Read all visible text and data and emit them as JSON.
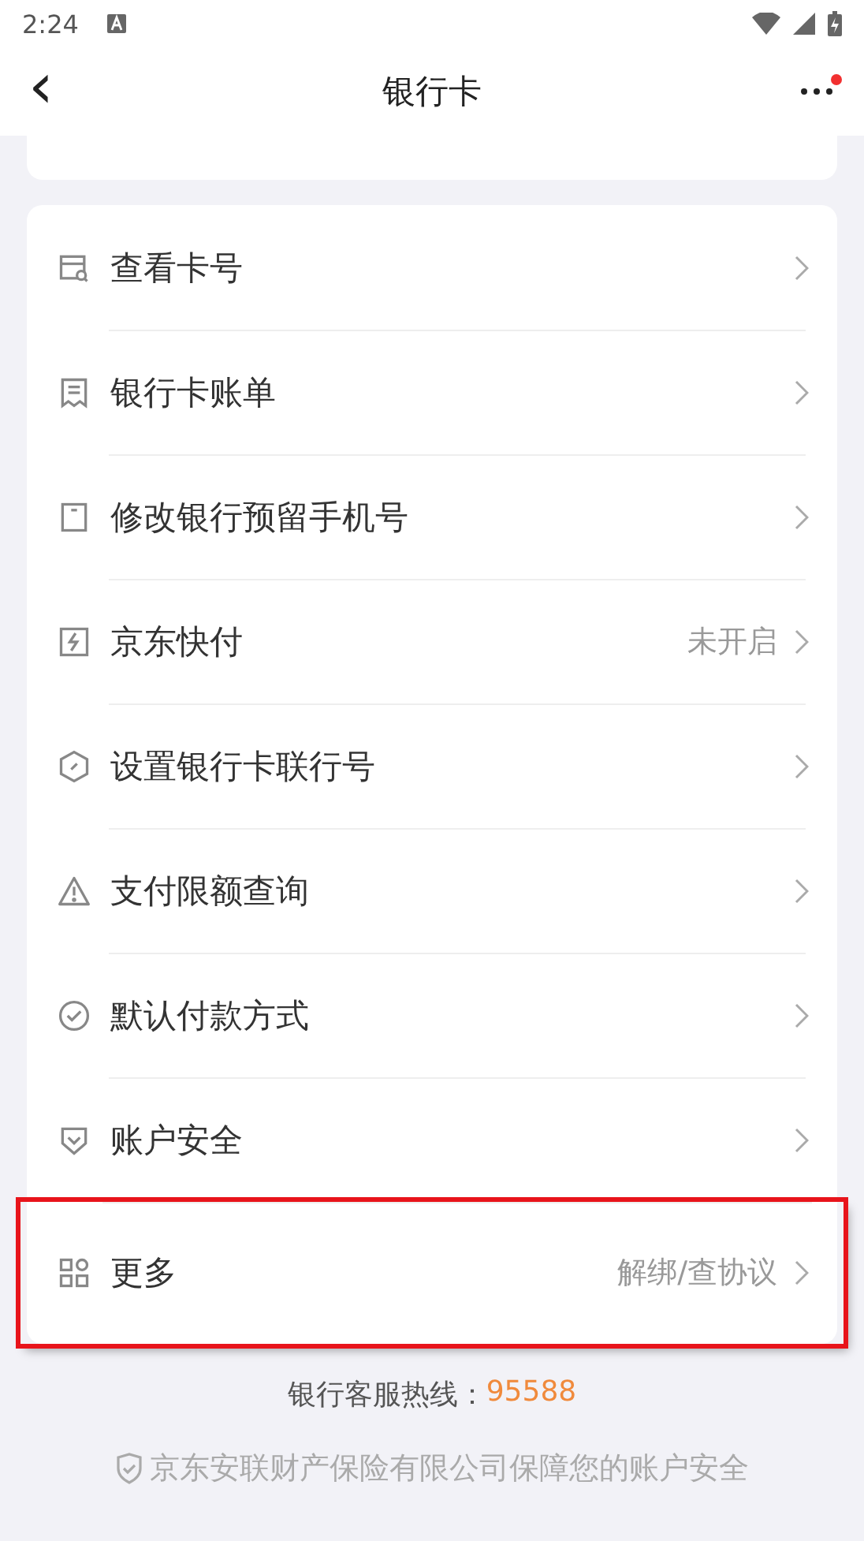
{
  "status_bar": {
    "time": "2:24"
  },
  "nav": {
    "back": "‹",
    "title": "银行卡",
    "has_notification": true
  },
  "items": [
    {
      "kind": "card-search",
      "label": "查看卡号",
      "highlighted": false
    },
    {
      "kind": "receipt",
      "label": "银行卡账单",
      "highlighted": false
    },
    {
      "kind": "phone",
      "label": "修改银行预留手机号",
      "highlighted": false
    },
    {
      "kind": "flash",
      "label": "京东快付",
      "value": "未开启",
      "highlighted": false
    },
    {
      "kind": "hexagon",
      "label": "设置银行卡联行号",
      "highlighted": false
    },
    {
      "kind": "warning",
      "label": "支付限额查询",
      "highlighted": false
    },
    {
      "kind": "check",
      "label": "默认付款方式",
      "highlighted": false
    },
    {
      "kind": "shield",
      "label": "账户安全",
      "highlighted": false
    },
    {
      "kind": "grid",
      "label": "更多",
      "value": "解绑/查协议",
      "highlighted": true
    }
  ],
  "hotline": {
    "label": "银行客服热线：",
    "number": "95588"
  },
  "insurance": "京东安联财产保险有限公司保障您的账户安全"
}
